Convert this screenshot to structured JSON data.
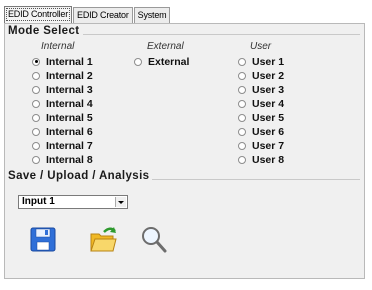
{
  "tabs": [
    "EDID Controller",
    "EDID Creator",
    "System"
  ],
  "mode_select": {
    "title": "Mode Select",
    "columns": {
      "internal": {
        "heading": "Internal",
        "options": [
          "Internal 1",
          "Internal 2",
          "Internal 3",
          "Internal 4",
          "Internal 5",
          "Internal 6",
          "Internal 7",
          "Internal 8"
        ]
      },
      "external": {
        "heading": "External",
        "options": [
          "External"
        ]
      },
      "user": {
        "heading": "User",
        "options": [
          "User 1",
          "User 2",
          "User 3",
          "User 4",
          "User 5",
          "User 6",
          "User 7",
          "User 8"
        ]
      }
    },
    "selected": "Internal 1"
  },
  "save_upload": {
    "title": "Save / Upload / Analysis",
    "input_select": {
      "value": "Input 1"
    },
    "icons": [
      "save-icon",
      "open-folder-icon",
      "magnifier-icon"
    ],
    "colors": {
      "save": "#2f6fd8",
      "folder": "#f4c442",
      "arrow": "#2e9a2e"
    }
  }
}
